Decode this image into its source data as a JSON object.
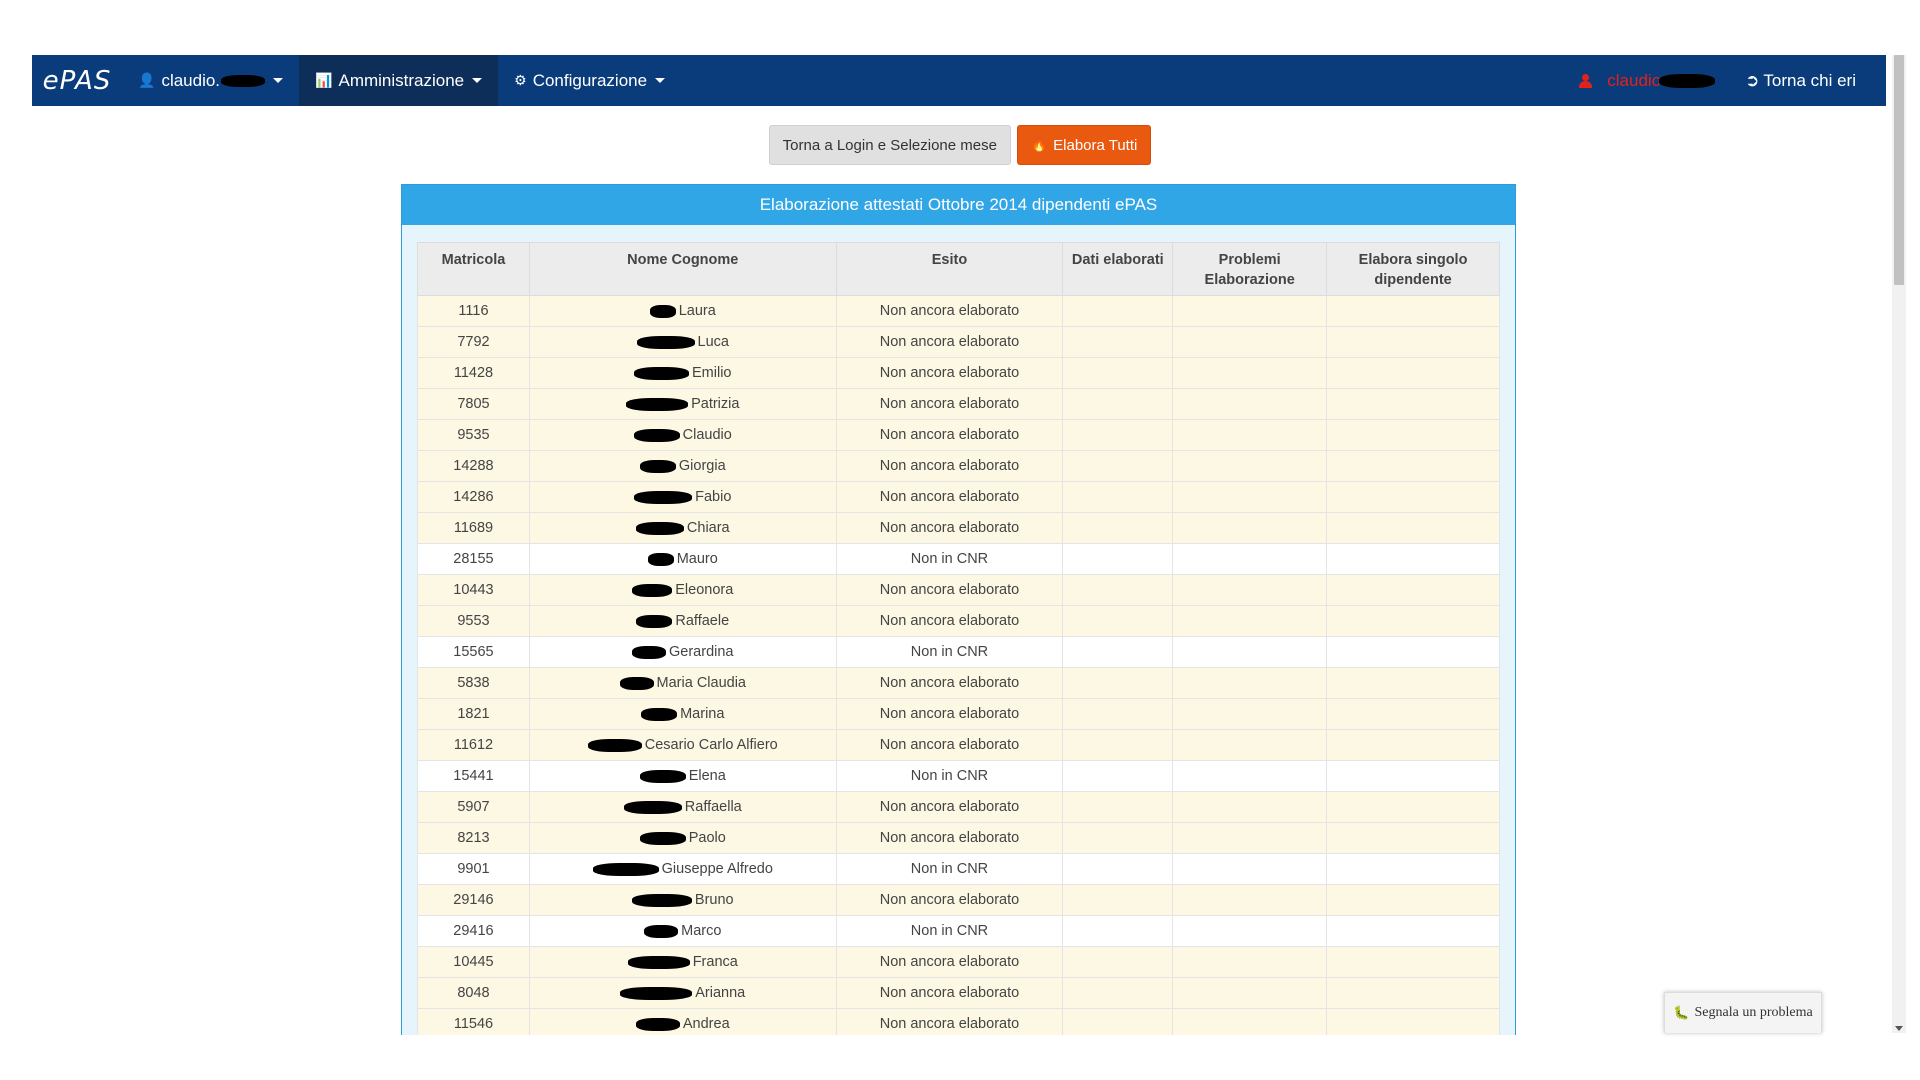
{
  "navbar": {
    "brand": "ePAS",
    "user_menu": "claudio.",
    "admin_menu": "Amministrazione",
    "config_menu": "Configurazione",
    "current_user": "claudio",
    "logout": "Torna chi eri"
  },
  "actions": {
    "back_label": "Torna a Login e Selezione mese",
    "process_all_label": "Elabora Tutti"
  },
  "panel": {
    "title": "Elaborazione attestati Ottobre 2014 dipendenti ePAS"
  },
  "table": {
    "headers": {
      "matricola": "Matricola",
      "nome": "Nome Cognome",
      "esito": "Esito",
      "dati": "Dati elaborati",
      "problemi": "Problemi Elaborazione",
      "elabora": "Elabora singolo dipendente"
    },
    "rows": [
      {
        "matricola": "1116",
        "nome": "Laura",
        "esito": "Non ancora elaborato"
      },
      {
        "matricola": "7792",
        "nome": "Luca",
        "esito": "Non ancora elaborato"
      },
      {
        "matricola": "11428",
        "nome": "Emilio",
        "esito": "Non ancora elaborato"
      },
      {
        "matricola": "7805",
        "nome": "Patrizia",
        "esito": "Non ancora elaborato"
      },
      {
        "matricola": "9535",
        "nome": "Claudio",
        "esito": "Non ancora elaborato"
      },
      {
        "matricola": "14288",
        "nome": "Giorgia",
        "esito": "Non ancora elaborato"
      },
      {
        "matricola": "14286",
        "nome": "Fabio",
        "esito": "Non ancora elaborato"
      },
      {
        "matricola": "11689",
        "nome": "Chiara",
        "esito": "Non ancora elaborato"
      },
      {
        "matricola": "28155",
        "nome": "Mauro",
        "esito": "Non in CNR"
      },
      {
        "matricola": "10443",
        "nome": "Eleonora",
        "esito": "Non ancora elaborato"
      },
      {
        "matricola": "9553",
        "nome": "Raffaele",
        "esito": "Non ancora elaborato"
      },
      {
        "matricola": "15565",
        "nome": "Gerardina",
        "esito": "Non in CNR"
      },
      {
        "matricola": "5838",
        "nome": "Maria Claudia",
        "esito": "Non ancora elaborato"
      },
      {
        "matricola": "1821",
        "nome": "Marina",
        "esito": "Non ancora elaborato"
      },
      {
        "matricola": "11612",
        "nome": "Cesario Carlo Alfiero",
        "esito": "Non ancora elaborato"
      },
      {
        "matricola": "15441",
        "nome": "Elena",
        "esito": "Non in CNR"
      },
      {
        "matricola": "5907",
        "nome": "Raffaella",
        "esito": "Non ancora elaborato"
      },
      {
        "matricola": "8213",
        "nome": "Paolo",
        "esito": "Non ancora elaborato"
      },
      {
        "matricola": "9901",
        "nome": "Giuseppe Alfredo",
        "esito": "Non in CNR"
      },
      {
        "matricola": "29146",
        "nome": "Bruno",
        "esito": "Non ancora elaborato"
      },
      {
        "matricola": "29416",
        "nome": "Marco",
        "esito": "Non in CNR"
      },
      {
        "matricola": "10445",
        "nome": "Franca",
        "esito": "Non ancora elaborato"
      },
      {
        "matricola": "8048",
        "nome": "Arianna",
        "esito": "Non ancora elaborato"
      },
      {
        "matricola": "11546",
        "nome": "Andrea",
        "esito": "Non ancora elaborato"
      }
    ]
  },
  "footer": {
    "report_label": "Segnala un problema"
  },
  "colors": {
    "navbar": "#0a3b7a",
    "panel_heading": "#31a6e6",
    "orange_button": "#e9590f",
    "row_warning": "#fcf8e3",
    "user_red": "#e3211b"
  },
  "icons": [
    "user-icon",
    "chart-icon",
    "gear-icon",
    "person-icon",
    "logout-icon",
    "fire-icon",
    "bug-icon"
  ]
}
